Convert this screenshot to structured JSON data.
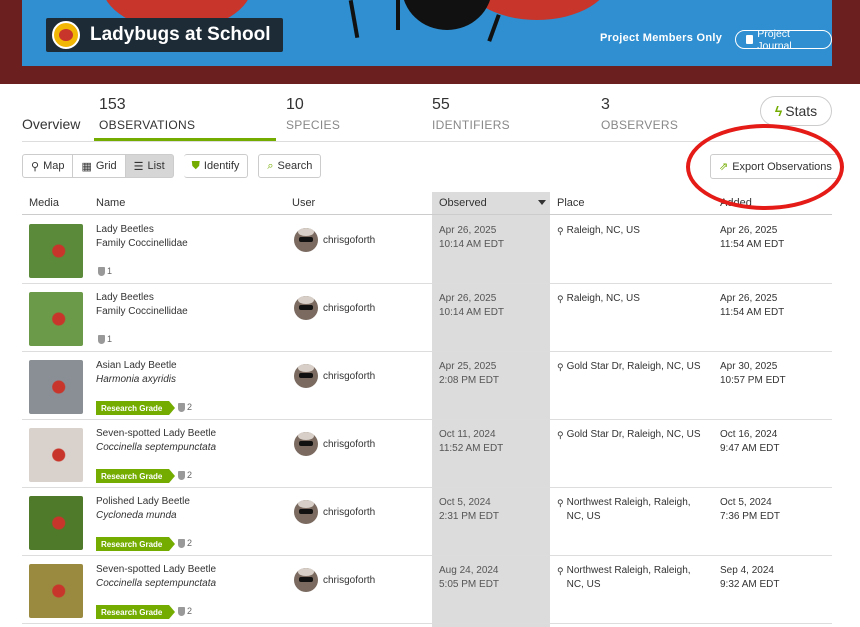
{
  "banner": {
    "title": "Ladybugs at School",
    "members_label": "Project Members Only",
    "journal_label": "Project Journal"
  },
  "tabs": {
    "overview": "Overview",
    "observations": {
      "count": "153",
      "label": "OBSERVATIONS"
    },
    "species": {
      "count": "10",
      "label": "SPECIES"
    },
    "identifiers": {
      "count": "55",
      "label": "IDENTIFIERS"
    },
    "observers": {
      "count": "3",
      "label": "OBSERVERS"
    },
    "stats_label": "Stats"
  },
  "toolbar": {
    "map": "Map",
    "grid": "Grid",
    "list": "List",
    "identify": "Identify",
    "search": "Search",
    "export": "Export Observations"
  },
  "table": {
    "headers": {
      "media": "Media",
      "name": "Name",
      "user": "User",
      "observed": "Observed",
      "place": "Place",
      "added": "Added"
    },
    "rows": [
      {
        "common": "Lady Beetles",
        "sci": "Family Coccinellidae",
        "sci_italic": false,
        "research": "",
        "ids": "1",
        "user": "chrisgoforth",
        "obs_date": "Apr 26, 2025",
        "obs_time": "10:14 AM EDT",
        "place1": "Raleigh, NC, US",
        "place2": "",
        "added_date": "Apr 26, 2025",
        "added_time": "11:54 AM EDT",
        "thumb": "#5a8a3a"
      },
      {
        "common": "Lady Beetles",
        "sci": "Family Coccinellidae",
        "sci_italic": false,
        "research": "",
        "ids": "1",
        "user": "chrisgoforth",
        "obs_date": "Apr 26, 2025",
        "obs_time": "10:14 AM EDT",
        "place1": "Raleigh, NC, US",
        "place2": "",
        "added_date": "Apr 26, 2025",
        "added_time": "11:54 AM EDT",
        "thumb": "#6b9a48"
      },
      {
        "common": "Asian Lady Beetle",
        "sci": "Harmonia axyridis",
        "sci_italic": true,
        "research": "Research Grade",
        "ids": "2",
        "user": "chrisgoforth",
        "obs_date": "Apr 25, 2025",
        "obs_time": "2:08 PM EDT",
        "place1": "Gold Star Dr, Raleigh, NC, US",
        "place2": "",
        "added_date": "Apr 30, 2025",
        "added_time": "10:57 PM EDT",
        "thumb": "#8a8f95"
      },
      {
        "common": "Seven-spotted Lady Beetle",
        "sci": "Coccinella septempunctata",
        "sci_italic": true,
        "research": "Research Grade",
        "ids": "2",
        "user": "chrisgoforth",
        "obs_date": "Oct 11, 2024",
        "obs_time": "11:52 AM EDT",
        "place1": "Gold Star Dr, Raleigh, NC, US",
        "place2": "",
        "added_date": "Oct 16, 2024",
        "added_time": "9:47 AM EDT",
        "thumb": "#d9d2cc"
      },
      {
        "common": "Polished Lady Beetle",
        "sci": "Cycloneda munda",
        "sci_italic": true,
        "research": "Research Grade",
        "ids": "2",
        "user": "chrisgoforth",
        "obs_date": "Oct 5, 2024",
        "obs_time": "2:31 PM EDT",
        "place1": "Northwest Raleigh, Raleigh,",
        "place2": "NC, US",
        "added_date": "Oct 5, 2024",
        "added_time": "7:36 PM EDT",
        "thumb": "#4f7a2a"
      },
      {
        "common": "Seven-spotted Lady Beetle",
        "sci": "Coccinella septempunctata",
        "sci_italic": true,
        "research": "Research Grade",
        "ids": "2",
        "user": "chrisgoforth",
        "obs_date": "Aug 24, 2024",
        "obs_time": "5:05 PM EDT",
        "place1": "Northwest Raleigh, Raleigh,",
        "place2": "NC, US",
        "added_date": "Sep 4, 2024",
        "added_time": "9:32 AM EDT",
        "thumb": "#9a8a40"
      }
    ]
  }
}
